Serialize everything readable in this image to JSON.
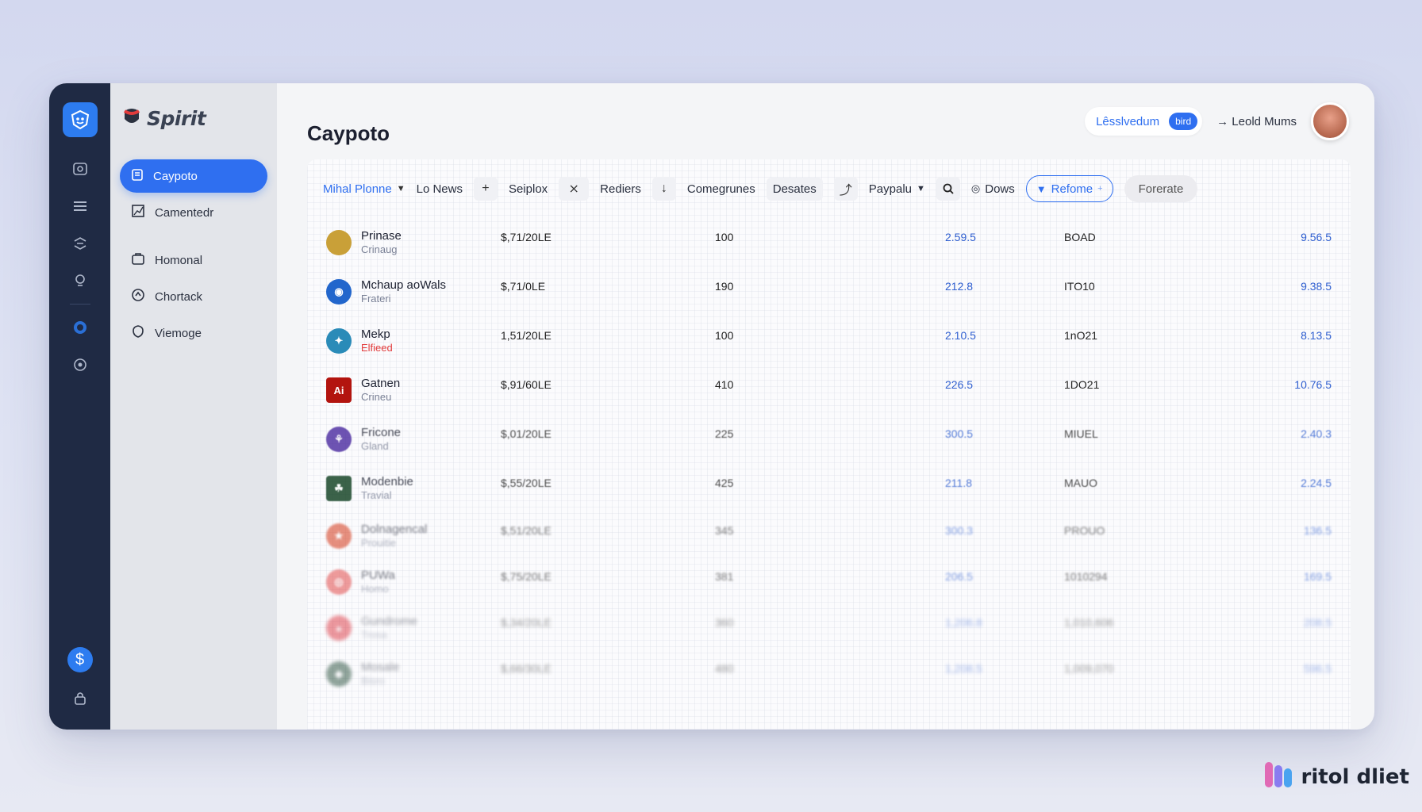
{
  "app": {
    "brand": "Spirit",
    "page_title": "Caypoto"
  },
  "sidebar": {
    "items": [
      {
        "label": "Caypoto",
        "icon": "clipboard-icon",
        "active": true
      },
      {
        "label": "Camentedr",
        "icon": "chart-box-icon",
        "active": false
      },
      {
        "label": "Homonal",
        "icon": "briefcase-icon",
        "active": false
      },
      {
        "label": "Chortack",
        "icon": "refresh-circle-icon",
        "active": false
      },
      {
        "label": "Viemoge",
        "icon": "shield-icon",
        "active": false
      }
    ]
  },
  "topbar": {
    "search_text": "Lêsslvedum",
    "search_badge": "bird",
    "link": "Leold Mums"
  },
  "toolbar": {
    "filter_label": "Mihal Plonne",
    "news": "Lo News",
    "seiplox": "Seiplox",
    "rediers": "Rediers",
    "comegrunes": "Comegrunes",
    "desates": "Desates",
    "paypaly": "Paypalu",
    "dows": "Dows",
    "refome": "Refome",
    "forerate": "Forerate"
  },
  "rows": [
    {
      "name": "Prinase",
      "sub": "Crinaug",
      "sub_red": false,
      "price": "$,71/20LE",
      "qty": "100",
      "change": "2.59.5",
      "code": "BOAD",
      "last": "9.56.5",
      "coin_color": "#c9a038",
      "coin_glyph": "",
      "coin_shape": "circle",
      "blur": 0
    },
    {
      "name": "Mchaup aoWals",
      "sub": "Frateri",
      "sub_red": false,
      "price": "$,71/‌0LE",
      "qty": "190",
      "change": "212.8",
      "code": "ITO10",
      "last": "9.38.5",
      "coin_color": "#2266cc",
      "coin_glyph": "◉",
      "coin_shape": "circle",
      "blur": 0
    },
    {
      "name": "Mekp",
      "sub": "Elfieed",
      "sub_red": true,
      "price": "1,51/20LE",
      "qty": "100",
      "change": "2.10.5",
      "code": "1nO21",
      "last": "8.13.5",
      "coin_color": "#2a8bb8",
      "coin_glyph": "✦",
      "coin_shape": "circle",
      "blur": 0
    },
    {
      "name": "Gatnen",
      "sub": "Crineu",
      "sub_red": false,
      "price": "$,91/60LE",
      "qty": "410",
      "change": "226.5",
      "code": "1DO21",
      "last": "10.76.5",
      "coin_color": "#b3140f",
      "coin_glyph": "Ai",
      "coin_shape": "square",
      "blur": 0
    },
    {
      "name": "Fricone",
      "sub": "Gland",
      "sub_red": false,
      "price": "$,01/20LE",
      "qty": "225",
      "change": "300.5",
      "code": "MIUEL",
      "last": "2.40.3",
      "coin_color": "#4a2aa0",
      "coin_glyph": "⚘",
      "coin_shape": "circle",
      "blur": 1
    },
    {
      "name": "Modenbie",
      "sub": "Travial",
      "sub_red": false,
      "price": "$,55/20LE",
      "qty": "425",
      "change": "211.8",
      "code": "MAUO",
      "last": "2.24.5",
      "coin_color": "#0c3d1d",
      "coin_glyph": "☘",
      "coin_shape": "square",
      "blur": 1
    },
    {
      "name": "Dolnagencal",
      "sub": "Prouitie",
      "sub_red": false,
      "price": "$,51/20LE",
      "qty": "345",
      "change": "300.3",
      "code": "PROUO",
      "last": "136.5",
      "coin_color": "#d8472a",
      "coin_glyph": "★",
      "coin_shape": "circle",
      "blur": 2
    },
    {
      "name": "PUWa",
      "sub": "Homo",
      "sub_red": false,
      "price": "$,75/20LE",
      "qty": "381",
      "change": "206.5",
      "code": "1010294",
      "last": "169.5",
      "coin_color": "#e45a5a",
      "coin_glyph": "◎",
      "coin_shape": "circle",
      "blur": 2
    },
    {
      "name": "Gundrome",
      "sub": "Trosa",
      "sub_red": false,
      "price": "$,34/20LE",
      "qty": "360",
      "change": "1,206.8",
      "code": "1,010,606",
      "last": "208.5",
      "coin_color": "#d91f2b",
      "coin_glyph": "●",
      "coin_shape": "circle",
      "blur": 3
    },
    {
      "name": "Mosale",
      "sub": "Bisro",
      "sub_red": false,
      "price": "$,66/30LE",
      "qty": "480",
      "change": "1,208.5",
      "code": "1,009,070",
      "last": "596.5",
      "coin_color": "#0e3a24",
      "coin_glyph": "◆",
      "coin_shape": "circle",
      "blur": 3
    }
  ],
  "watermark": "ritol dliet",
  "colors": {
    "accent": "#2f6ff0",
    "rail": "#1f2a44",
    "sidebar": "#e3e5ea"
  }
}
